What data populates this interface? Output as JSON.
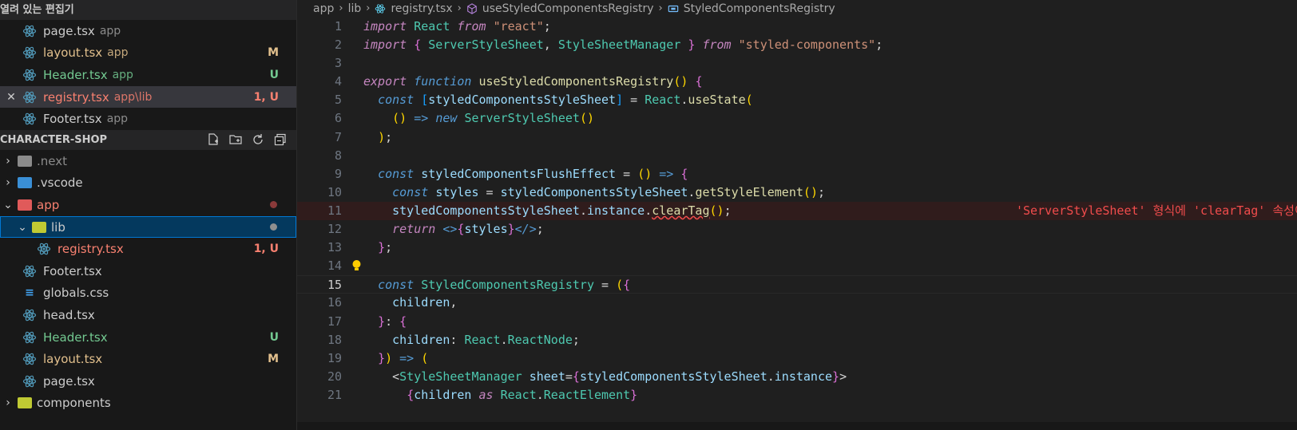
{
  "open_editors": {
    "title": "열려 있는 편집기",
    "items": [
      {
        "name": "page.tsx",
        "dir": "app",
        "status": "",
        "status_type": "",
        "active": false
      },
      {
        "name": "layout.tsx",
        "dir": "app",
        "status": "M",
        "status_type": "mod",
        "active": false
      },
      {
        "name": "Header.tsx",
        "dir": "app",
        "status": "U",
        "status_type": "untr",
        "active": false
      },
      {
        "name": "registry.tsx",
        "dir": "app\\lib",
        "status": "1, U",
        "status_type": "err",
        "active": true,
        "close": "✕"
      },
      {
        "name": "Footer.tsx",
        "dir": "app",
        "status": "",
        "status_type": "",
        "active": false
      }
    ]
  },
  "explorer": {
    "title": "CHARACTER-SHOP",
    "icons": [
      "new-file-icon",
      "new-folder-icon",
      "refresh-icon",
      "collapse-all-icon"
    ],
    "tree": [
      {
        "label": ".next",
        "type": "folder",
        "chev": "›",
        "color": "#8b8b8b"
      },
      {
        "label": ".vscode",
        "type": "folder",
        "chev": "›",
        "color": "#cccccc"
      },
      {
        "label": "app",
        "type": "folder-open",
        "chev": "⌄",
        "color": "#f88070"
      },
      {
        "label": "lib",
        "type": "folder-open",
        "chev": "⌄",
        "color": "#cccccc"
      },
      {
        "label": "registry.tsx",
        "type": "react",
        "color": "#f88070",
        "status": "1, U"
      },
      {
        "label": "Footer.tsx",
        "type": "react",
        "color": "#cccccc"
      },
      {
        "label": "globals.css",
        "type": "css",
        "color": "#cccccc"
      },
      {
        "label": "head.tsx",
        "type": "react",
        "color": "#cccccc"
      },
      {
        "label": "Header.tsx",
        "type": "react",
        "color": "#73c991",
        "status": "U"
      },
      {
        "label": "layout.tsx",
        "type": "react",
        "color": "#e2c08d",
        "status": "M"
      },
      {
        "label": "page.tsx",
        "type": "react",
        "color": "#cccccc"
      },
      {
        "label": "components",
        "type": "folder",
        "chev": "›",
        "color": "#cccccc"
      }
    ]
  },
  "breadcrumbs": [
    "app",
    "lib",
    "registry.tsx",
    "useStyledComponentsRegistry",
    "StyledComponentsRegistry"
  ],
  "code": {
    "current_line": 15,
    "error_line": 11,
    "lines": [
      "import React from \"react\";",
      "import { ServerStyleSheet, StyleSheetManager } from \"styled-components\";",
      "",
      "export function useStyledComponentsRegistry() {",
      "  const [styledComponentsStyleSheet] = React.useState(",
      "    () => new ServerStyleSheet()",
      "  );",
      "",
      "  const styledComponentsFlushEffect = () => {",
      "    const styles = styledComponentsStyleSheet.getStyleElement();",
      "    styledComponentsStyleSheet.instance.clearTag();",
      "    return <>{styles}</>;",
      "  };",
      "",
      "  const StyledComponentsRegistry = ({",
      "    children,",
      "  }: {",
      "    children: React.ReactNode;",
      "  }) => (",
      "    <StyleSheetManager sheet={styledComponentsStyleSheet.instance}>",
      "      {children as React.ReactElement}"
    ],
    "error_message": "'ServerStyleSheet' 형식에 'clearTag' 속성이 없습니다."
  },
  "colors": {
    "accent": "#0078d4",
    "modified": "#e2c08d",
    "untracked": "#73c991",
    "error": "#f88070"
  }
}
